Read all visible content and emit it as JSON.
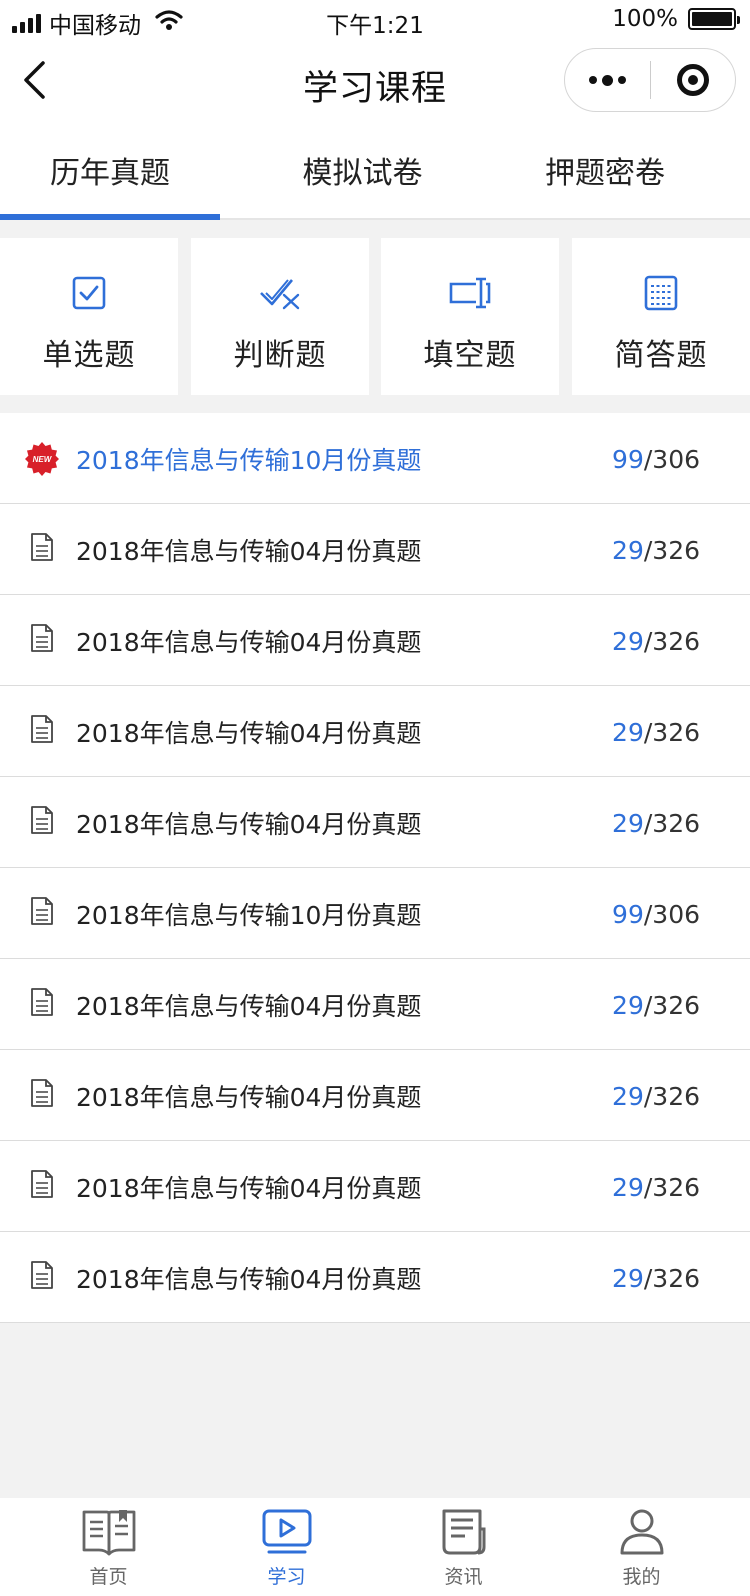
{
  "status_bar": {
    "carrier": "中国移动",
    "time": "下午1:21",
    "battery": "100%"
  },
  "nav": {
    "title": "学习课程"
  },
  "tabs": [
    {
      "label": "历年真题",
      "active": true
    },
    {
      "label": "模拟试卷",
      "active": false
    },
    {
      "label": "押题密卷",
      "active": false
    }
  ],
  "categories": [
    {
      "label": "单选题",
      "icon": "checkbox-icon"
    },
    {
      "label": "判断题",
      "icon": "check-cross-icon"
    },
    {
      "label": "填空题",
      "icon": "text-cursor-icon"
    },
    {
      "label": "简答题",
      "icon": "grid-doc-icon"
    }
  ],
  "papers": [
    {
      "title": "2018年信息与传输10月份真题",
      "done": "99",
      "total": "/306",
      "is_new": true
    },
    {
      "title": "2018年信息与传输04月份真题",
      "done": "29",
      "total": "/326",
      "is_new": false
    },
    {
      "title": "2018年信息与传输04月份真题",
      "done": "29",
      "total": "/326",
      "is_new": false
    },
    {
      "title": "2018年信息与传输04月份真题",
      "done": "29",
      "total": "/326",
      "is_new": false
    },
    {
      "title": "2018年信息与传输04月份真题",
      "done": "29",
      "total": "/326",
      "is_new": false
    },
    {
      "title": "2018年信息与传输10月份真题",
      "done": "99",
      "total": "/306",
      "is_new": false
    },
    {
      "title": "2018年信息与传输04月份真题",
      "done": "29",
      "total": "/326",
      "is_new": false
    },
    {
      "title": "2018年信息与传输04月份真题",
      "done": "29",
      "total": "/326",
      "is_new": false
    },
    {
      "title": "2018年信息与传输04月份真题",
      "done": "29",
      "total": "/326",
      "is_new": false
    },
    {
      "title": "2018年信息与传输04月份真题",
      "done": "29",
      "total": "/326",
      "is_new": false
    }
  ],
  "new_badge": "NEW",
  "tabbar": [
    {
      "label": "首页",
      "icon": "book-icon",
      "active": false
    },
    {
      "label": "学习",
      "icon": "play-video-icon",
      "active": true
    },
    {
      "label": "资讯",
      "icon": "news-icon",
      "active": false
    },
    {
      "label": "我的",
      "icon": "user-icon",
      "active": false
    }
  ],
  "colors": {
    "accent": "#2f6fd8",
    "new_badge": "#d8202a",
    "background": "#f2f2f2"
  }
}
